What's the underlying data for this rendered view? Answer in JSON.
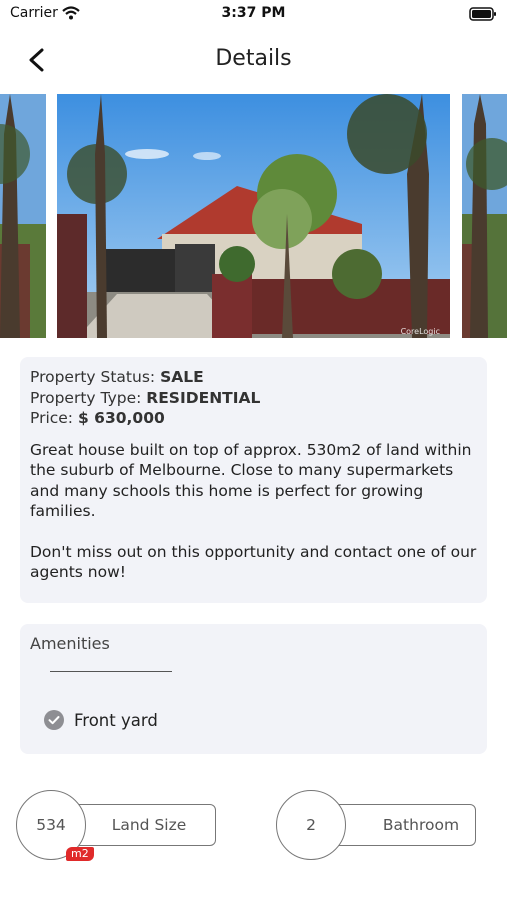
{
  "status_bar": {
    "carrier": "Carrier",
    "time": "3:37 PM"
  },
  "nav": {
    "title": "Details",
    "back_icon": "chevron-left-icon"
  },
  "carousel": {
    "watermark": "CoreLogic"
  },
  "property": {
    "status_label": "Property Status:",
    "status_value": "SALE",
    "type_label": "Property Type:",
    "type_value": "RESIDENTIAL",
    "price_label": "Price:",
    "price_value": "$ 630,000",
    "description": "Great house built on top of approx. 530m2 of land within the suburb of Melbourne. Close to many supermarkets and many schools this home is perfect for growing families.",
    "call_to_action": "Don't miss out on this opportunity and contact one of our agents now!"
  },
  "amenities": {
    "title": "Amenities",
    "items": [
      {
        "label": "Front yard",
        "icon": "check-circle-icon"
      }
    ]
  },
  "stats": {
    "land": {
      "value": "534",
      "label": "Land Size",
      "unit": "m2"
    },
    "bath": {
      "value": "2",
      "label": "Bathroom"
    }
  },
  "colors": {
    "card_bg": "#f2f3f8",
    "badge_red": "#e02a2a",
    "roof": "#b03a2e",
    "sky": "#3d8fe0"
  }
}
